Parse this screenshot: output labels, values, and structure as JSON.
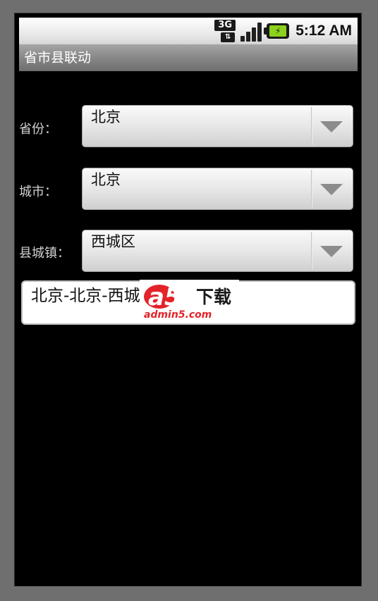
{
  "status_bar": {
    "network": "3G",
    "time": "5:12 AM",
    "icons": [
      "3g-data-icon",
      "signal-icon",
      "battery-charging-icon"
    ],
    "battery_color": "#8cd11b"
  },
  "app": {
    "title": "省市县联动"
  },
  "form": {
    "province": {
      "label": "省份：",
      "value": "北京"
    },
    "city": {
      "label": "城市：",
      "value": "北京"
    },
    "county": {
      "label": "县城镇：",
      "value": "西城区"
    },
    "result": "北京-北京-西城区"
  },
  "watermark": {
    "brand": "a5",
    "label": "下载",
    "site": "admin5.com"
  }
}
